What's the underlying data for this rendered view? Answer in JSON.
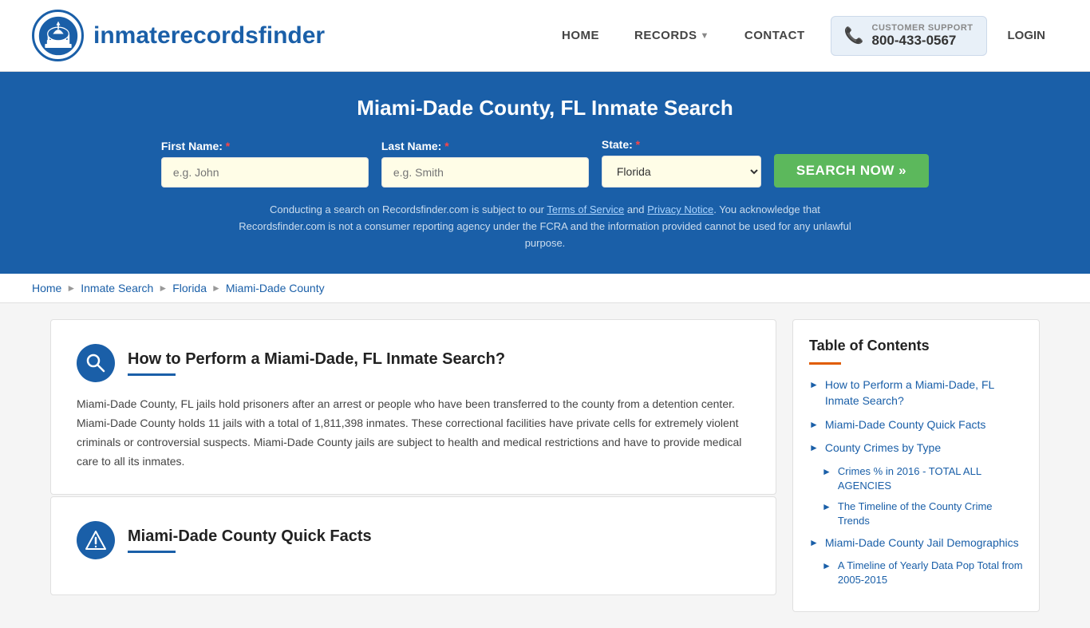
{
  "header": {
    "logo_text_light": "inmaterecords",
    "logo_text_bold": "finder",
    "nav": {
      "home": "HOME",
      "records": "RECORDS",
      "contact": "CONTACT",
      "login": "LOGIN"
    },
    "support": {
      "label": "CUSTOMER SUPPORT",
      "phone": "800-433-0567"
    }
  },
  "search_banner": {
    "title": "Miami-Dade County, FL Inmate Search",
    "first_name_label": "First Name:",
    "last_name_label": "Last Name:",
    "state_label": "State:",
    "first_name_placeholder": "e.g. John",
    "last_name_placeholder": "e.g. Smith",
    "state_value": "Florida",
    "search_btn": "SEARCH NOW »",
    "disclaimer": "Conducting a search on Recordsfinder.com is subject to our Terms of Service and Privacy Notice. You acknowledge that Recordsfinder.com is not a consumer reporting agency under the FCRA and the information provided cannot be used for any unlawful purpose."
  },
  "breadcrumb": {
    "items": [
      "Home",
      "Inmate Search",
      "Florida",
      "Miami-Dade County"
    ]
  },
  "main": {
    "cards": [
      {
        "id": "how-to",
        "icon": "search",
        "title": "How to Perform a Miami-Dade, FL Inmate Search?",
        "body": "Miami-Dade County, FL jails hold prisoners after an arrest or people who have been transferred to the county from a detention center. Miami-Dade County holds 11 jails with a total of 1,811,398 inmates. These correctional facilities have private cells for extremely violent criminals or controversial suspects. Miami-Dade County jails are subject to health and medical restrictions and have to provide medical care to all its inmates."
      },
      {
        "id": "quick-facts",
        "icon": "alert",
        "title": "Miami-Dade County Quick Facts",
        "body": ""
      }
    ]
  },
  "toc": {
    "title": "Table of Contents",
    "items": [
      {
        "label": "How to Perform a Miami-Dade, FL Inmate Search?",
        "sub": false
      },
      {
        "label": "Miami-Dade County Quick Facts",
        "sub": false
      },
      {
        "label": "County Crimes by Type",
        "sub": false
      },
      {
        "label": "Crimes % in 2016 - TOTAL ALL AGENCIES",
        "sub": true
      },
      {
        "label": "The Timeline of the County Crime Trends",
        "sub": true
      },
      {
        "label": "Miami-Dade County Jail Demographics",
        "sub": false
      },
      {
        "label": "A Timeline of Yearly Data Pop Total from 2005-2015",
        "sub": true
      }
    ]
  }
}
